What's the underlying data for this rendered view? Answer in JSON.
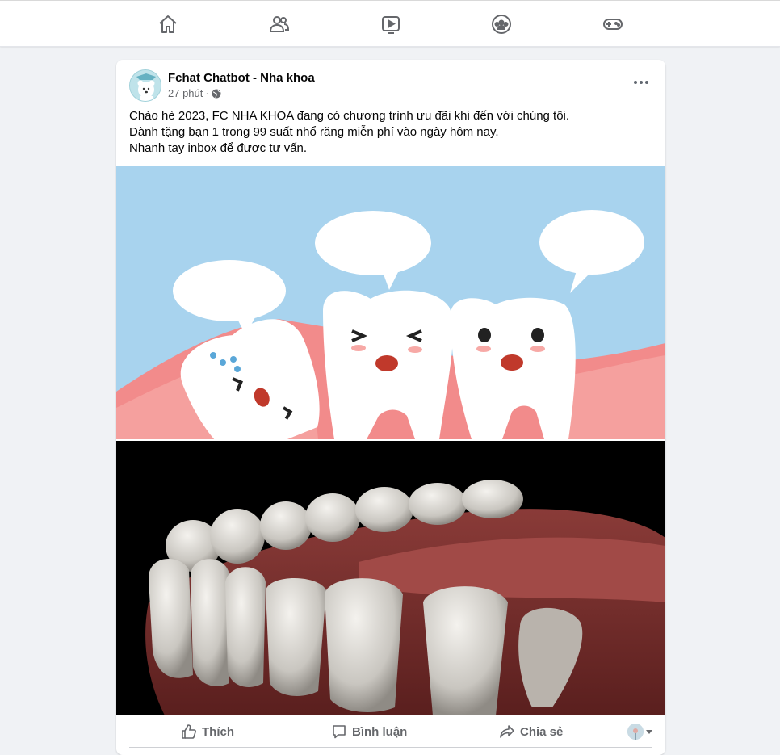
{
  "nav": {
    "items": [
      {
        "icon": "home-icon"
      },
      {
        "icon": "friends-icon"
      },
      {
        "icon": "watch-icon"
      },
      {
        "icon": "groups-icon"
      },
      {
        "icon": "gaming-icon"
      }
    ]
  },
  "post": {
    "author": "Fchat Chatbot - Nha khoa",
    "time": "27 phút",
    "separator": "·",
    "privacy_icon": "globe-icon",
    "text_lines": [
      "Chào hè 2023, FC NHA KHOA đang có chương trình ưu đãi khi đến với chúng tôi.",
      "Dành tặng bạn 1 trong 99 suất nhổ răng miễn phí vào ngày hôm nay.",
      "Nhanh tay inbox để được tư vấn."
    ],
    "actions": {
      "like": "Thích",
      "comment": "Bình luận",
      "share": "Chia sẻ"
    }
  },
  "colors": {
    "sky": "#a8d3ee",
    "gum": "#f28b8b",
    "tooth": "#ffffff",
    "text_secondary": "#65676b"
  }
}
